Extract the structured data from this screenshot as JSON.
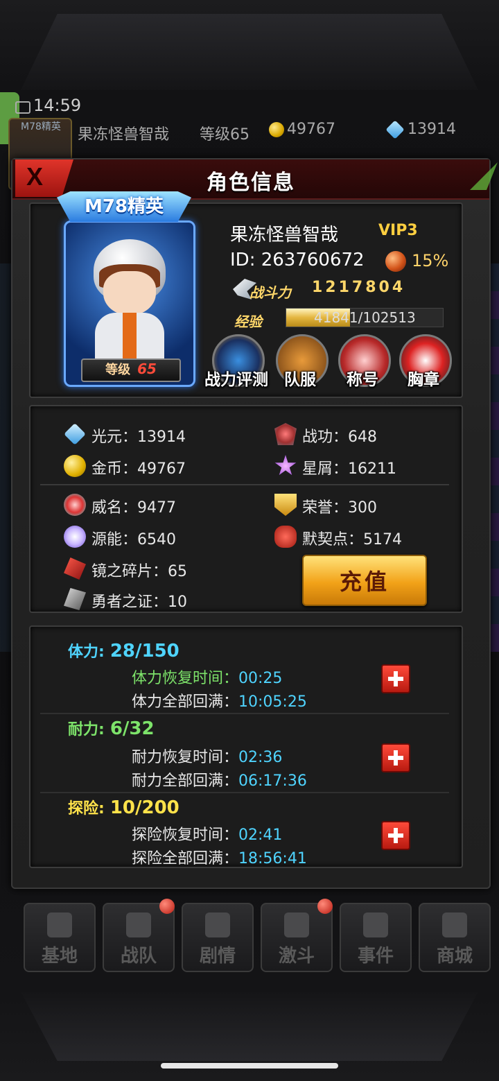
{
  "status": {
    "time": "14:59"
  },
  "topbar": {
    "rank": "M78精英",
    "name": "果冻怪兽智哉",
    "level": "等级65",
    "gold": "49767",
    "gems": "13914"
  },
  "dialog": {
    "title": "角色信息",
    "close_label": "X"
  },
  "profile": {
    "rank_banner": "M78精英",
    "level_label": "等级",
    "level_value": "65",
    "name": "果冻怪兽智哉",
    "vip": "VIP3",
    "id": "ID: 263760672",
    "bonus_pct": "15%",
    "power_label": "战斗力",
    "power_value": "1217804",
    "exp_label": "经验",
    "exp_text": "41841/102513",
    "exp_fraction": 0.408,
    "features": [
      "战力评测",
      "队服",
      "称号",
      "胸章"
    ]
  },
  "resources": {
    "guangyuan": "光元：13914",
    "zhangong": "战功：648",
    "jinbi": "金币：49767",
    "xingxie": "星屑：16211",
    "weiming": "威名：9477",
    "rongyu": "荣誉：300",
    "yuanneng": "源能：6540",
    "moqidian": "默契点：5174",
    "jingzhisuipian": "镜之碎片：65",
    "yongzhezhizheng": "勇者之证：10",
    "recharge_label": "充值"
  },
  "stamina": [
    {
      "label": "体力:",
      "value": "28/150",
      "color": "#4fd4ff",
      "line1_label": "体力恢复时间：",
      "line1_time": "00:25",
      "line1_color": "#7de36a",
      "line2_label": "体力全部回满：",
      "line2_time": "10:05:25"
    },
    {
      "label": "耐力:",
      "value": "6/32",
      "color": "#7de36a",
      "line1_label": "耐力恢复时间：",
      "line1_time": "02:36",
      "line1_color": "#e8e8e8",
      "line2_label": "耐力全部回满：",
      "line2_time": "06:17:36"
    },
    {
      "label": "探险:",
      "value": "10/200",
      "color": "#ffe24a",
      "line1_label": "探险恢复时间：",
      "line1_time": "02:41",
      "line1_color": "#e8e8e8",
      "line2_label": "探险全部回满：",
      "line2_time": "18:56:41"
    }
  ],
  "nav": [
    "基地",
    "战队",
    "剧情",
    "激斗",
    "事件",
    "商城"
  ]
}
